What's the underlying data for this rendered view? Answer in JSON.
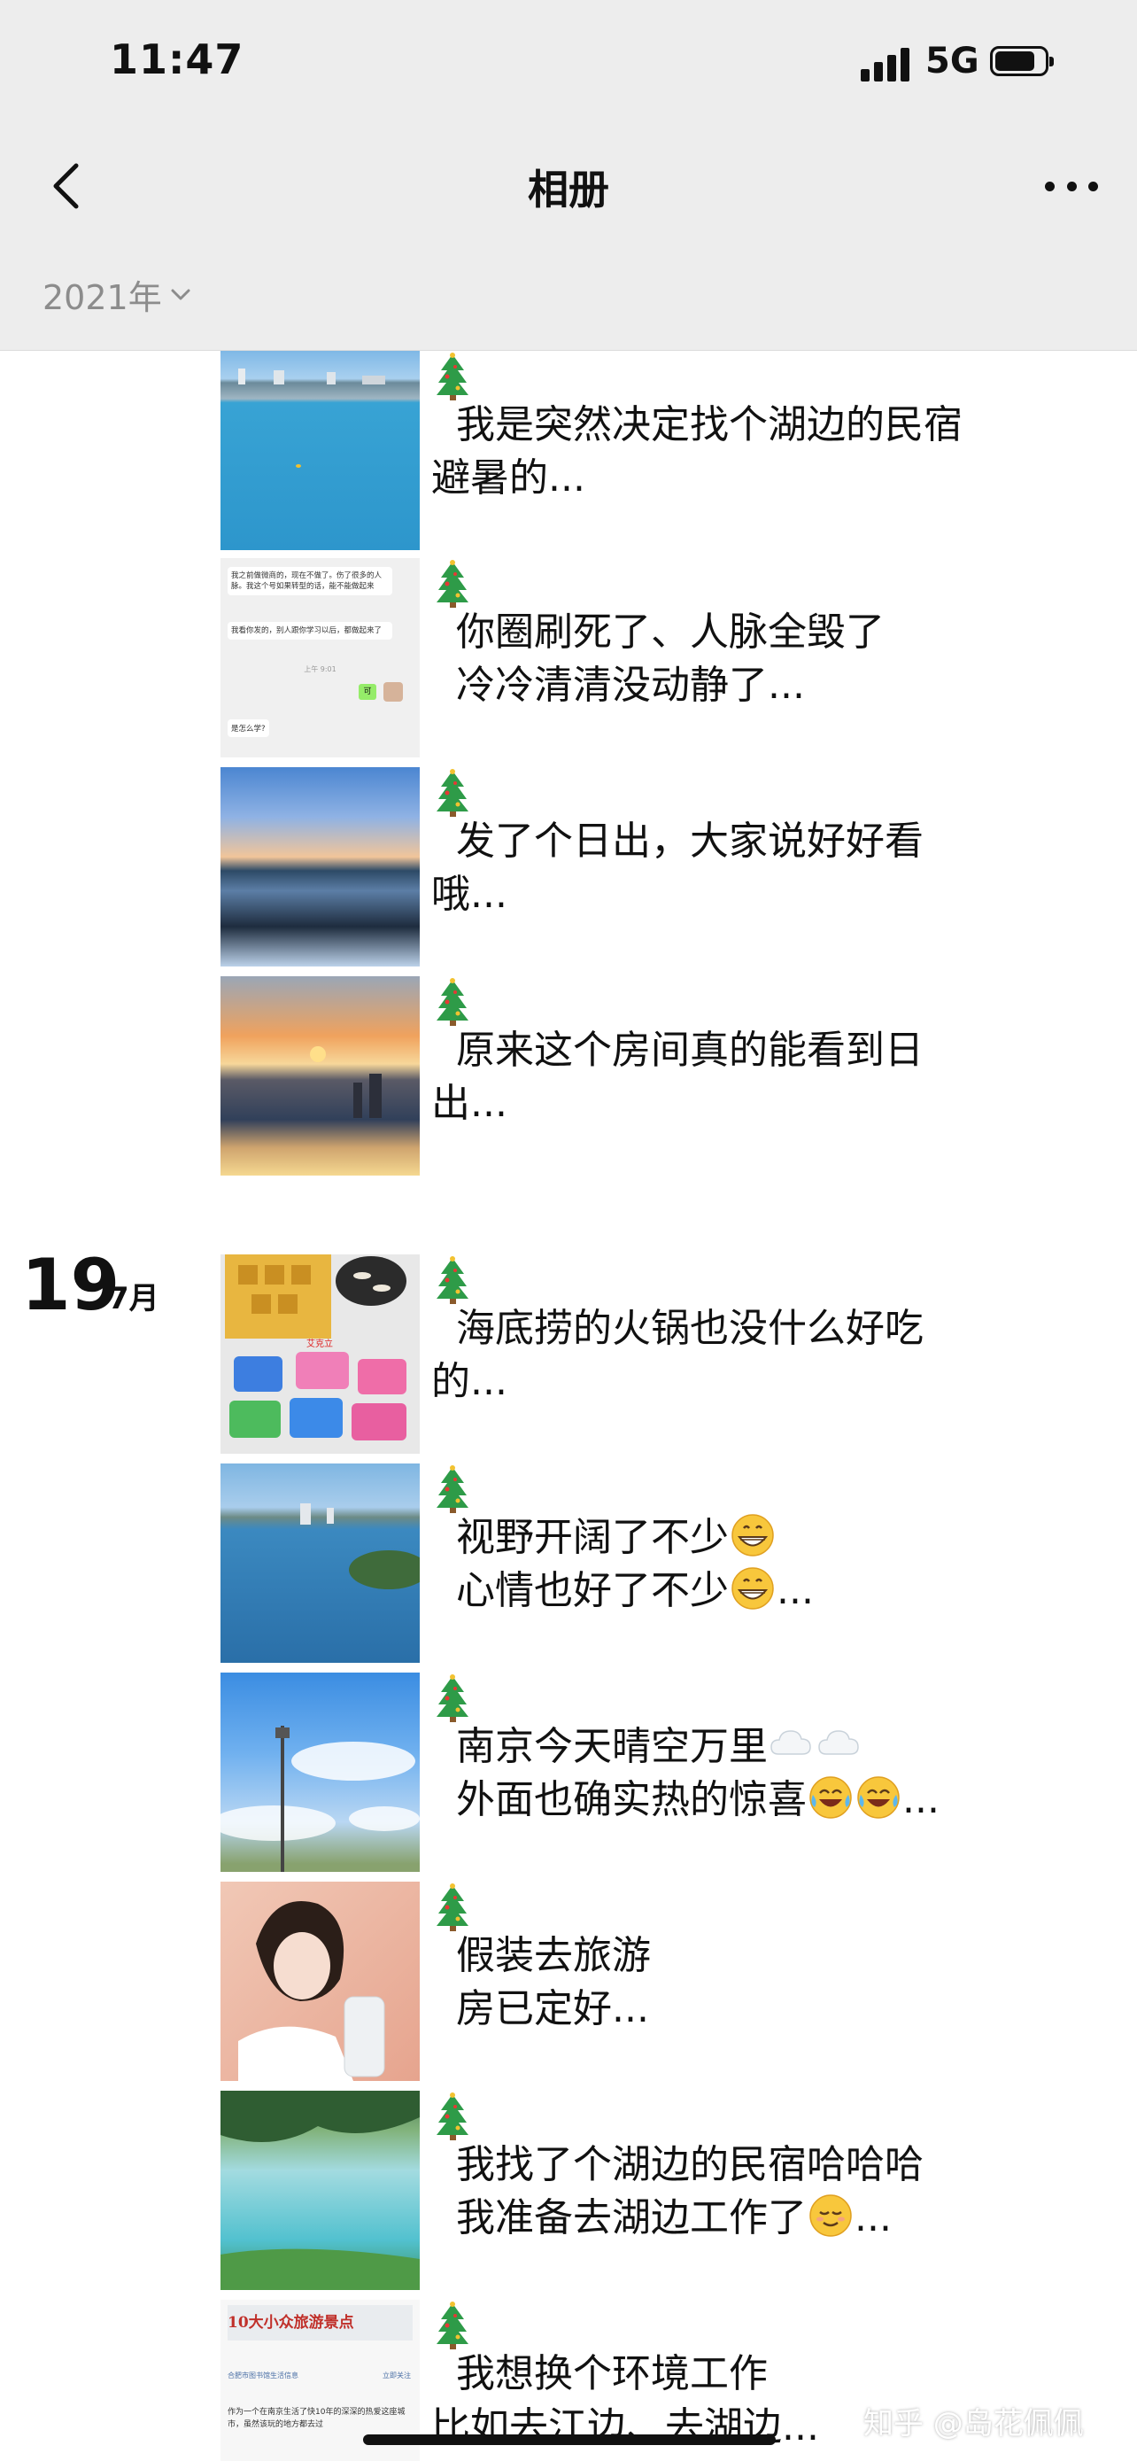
{
  "status_bar": {
    "time": "11:47",
    "network": "5G"
  },
  "nav": {
    "title": "相册"
  },
  "filter": {
    "year": "2021年"
  },
  "date_group": {
    "day": "19",
    "month": "7月"
  },
  "entries": [
    {
      "thumb": "lake-city-photo",
      "caption": "  我是突然决定找个湖边的民宿避暑的..."
    },
    {
      "thumb": "chat-screenshot",
      "caption": "  你圈刷死了、人脉全毁了\n  冷冷清清没动静了..."
    },
    {
      "thumb": "sunrise-lake-photo",
      "caption": "  发了个日出，大家说好好看哦..."
    },
    {
      "thumb": "sunrise-window-photo",
      "caption": "  原来这个房间真的能看到日出..."
    },
    {
      "thumb": "snacks-photo",
      "caption": "  海底捞的火锅也没什么好吃的..."
    },
    {
      "thumb": "lake-city-photo-2",
      "caption_line1": "  视野开阔了不少",
      "caption_line2": "  心情也好了不少",
      "caption_tail": "..."
    },
    {
      "thumb": "sky-tower-photo",
      "caption_line1": "  南京今天晴空万里",
      "caption_line2": "  外面也确实热的惊喜",
      "caption_tail": "..."
    },
    {
      "thumb": "portrait-photo",
      "caption": "  假装去旅游\n  房已定好..."
    },
    {
      "thumb": "lakeside-trees-photo",
      "caption_line1": "  我找了个湖边的民宿哈哈哈",
      "caption_line2": "  我准备去湖边工作了",
      "caption_tail": "..."
    },
    {
      "thumb": "article-screenshot",
      "caption": "  我想换个环境工作\n比如去江边、去湖边..."
    }
  ],
  "chat_thumb_text": {
    "msg1": "我之前做微商的，现在不做了。伤了很多的人脉。我这个号如果转型的话，能不能做起来",
    "msg2": "我看你发的，别人跟你学习以后，都做起来了",
    "time": "上午 9:01",
    "reply": "可",
    "msg3": "是怎么学?"
  },
  "snacks_thumb_text": {
    "label": "艾克立"
  },
  "article_thumb_text": {
    "headline": "10大小众旅游景点",
    "source": "合肥市图书馆生活信息",
    "follow": "立即关注",
    "body": "作为一个在南京生活了快10年的深深的热爱这座城市，虽然该玩的地方都去过"
  },
  "watermark": "知乎 @岛花佩佩",
  "colors": {
    "header_bg": "#ededed",
    "text": "#111111",
    "muted": "#8c8c8c"
  }
}
